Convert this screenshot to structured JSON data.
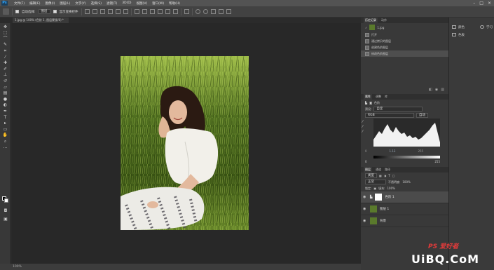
{
  "app": {
    "logo": "Ps"
  },
  "menubar": {
    "items": [
      "文件(F)",
      "编辑(E)",
      "图像(I)",
      "图层(L)",
      "文字(Y)",
      "选择(S)",
      "滤镜(T)",
      "3D(D)",
      "视图(V)",
      "窗口(W)",
      "帮助(H)"
    ],
    "window_buttons": [
      "–",
      "□",
      "×"
    ]
  },
  "options": {
    "auto_select_label": "自动选择:",
    "auto_select_value": "图层",
    "show_transform_label": "显示变换控件"
  },
  "document": {
    "tab_label": "1.jpg @ 100% (色阶 1, 图层蒙版/8) *"
  },
  "status": {
    "zoom": "100%"
  },
  "history": {
    "tabs": [
      "历史记录",
      "动作"
    ],
    "snapshot": "1.jpg",
    "items": [
      "打开",
      "通过拷贝的图层",
      "创建色阶图层",
      "修改色阶图层"
    ],
    "selected_index": 3
  },
  "properties": {
    "tabs": [
      "属性",
      "调整",
      "库"
    ],
    "title": "色阶",
    "preset_label": "预设:",
    "preset_value": "自定",
    "channel": "RGB",
    "auto_button": "自动",
    "input_black": "0",
    "input_gamma": "1.13",
    "input_white": "255",
    "output_black": "0",
    "output_white": "255"
  },
  "layers": {
    "tabs": [
      "图层",
      "通道",
      "路径"
    ],
    "kind_label": "类型",
    "blend_mode": "正常",
    "opacity_label": "不透明度:",
    "opacity": "100%",
    "lock_label": "锁定:",
    "fill_label": "填充:",
    "fill": "100%",
    "rows": [
      {
        "name": "色阶 1",
        "type": "adjustment",
        "selected": true
      },
      {
        "name": "图层 1",
        "type": "image",
        "selected": false
      },
      {
        "name": "背景",
        "type": "image",
        "selected": false
      }
    ]
  },
  "right_strip": {
    "items": [
      {
        "icon": "swatch-icon",
        "label": "颜色"
      },
      {
        "icon": "grid-icon",
        "label": "色板"
      },
      {
        "icon": "learn-icon",
        "label": "学习"
      }
    ]
  },
  "watermark": {
    "text": "UiBQ.CoM",
    "subtext": "PS 爱好者"
  },
  "colors": {
    "ui_bg": "#2b2b2b",
    "panel": "#393939",
    "accent": "#31a8ff",
    "grass": "#5a7a2c"
  }
}
